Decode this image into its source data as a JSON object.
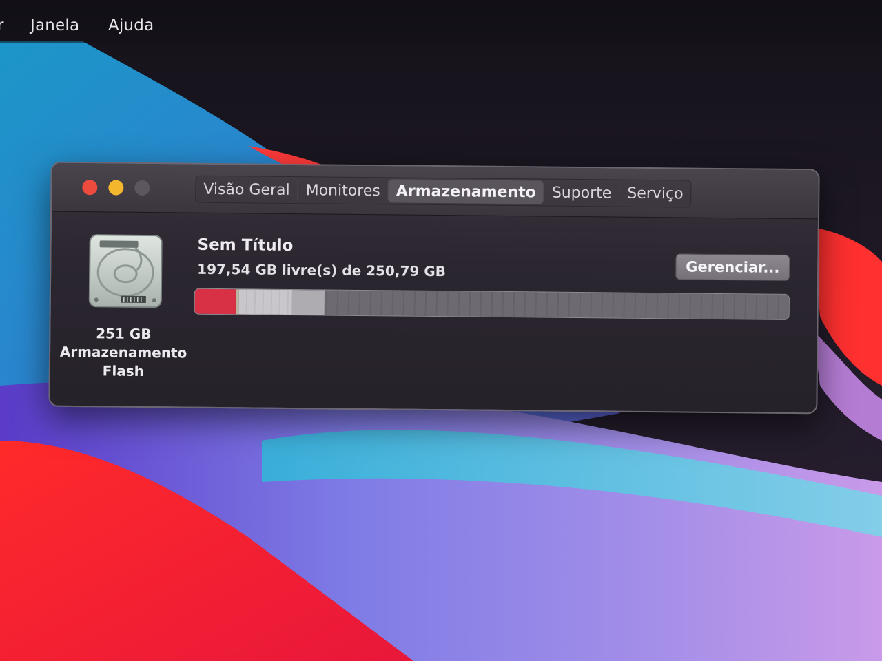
{
  "menubar": {
    "items": [
      "r",
      "Janela",
      "Ajuda"
    ]
  },
  "window": {
    "controls": {
      "close": "close-button",
      "minimize": "minimize-button",
      "zoom": "zoom-button"
    },
    "tabs": [
      {
        "label": "Visão Geral",
        "active": false
      },
      {
        "label": "Monitores",
        "active": false
      },
      {
        "label": "Armazenamento",
        "active": true
      },
      {
        "label": "Suporte",
        "active": false
      },
      {
        "label": "Serviço",
        "active": false
      }
    ],
    "disk": {
      "icon": "hard-drive-icon",
      "size_label": "251 GB",
      "type_label_1": "Armazenamento",
      "type_label_2": "Flash"
    },
    "volume": {
      "name": "Sem Título",
      "free_text": "197,54 GB livre(s) de 250,79 GB"
    },
    "manage_button": "Gerenciar...",
    "storage_usage": {
      "free_gb": 197.54,
      "total_gb": 250.79,
      "segments": [
        {
          "category": "system",
          "color": "#d83146",
          "fraction_of_total": 0.07
        },
        {
          "category": "apps",
          "color": "#b9b5a0",
          "fraction_of_total": 0.004
        },
        {
          "category": "other",
          "color": "#c9c6cb",
          "fraction_of_total": 0.09
        },
        {
          "category": "other2",
          "color": "#aeabb1",
          "fraction_of_total": 0.054
        }
      ]
    }
  },
  "colors": {
    "close": "#ee4b3f",
    "minimize": "#f4b62c",
    "zoom_inactive": "#5c575f",
    "system_segment": "#d83146"
  }
}
